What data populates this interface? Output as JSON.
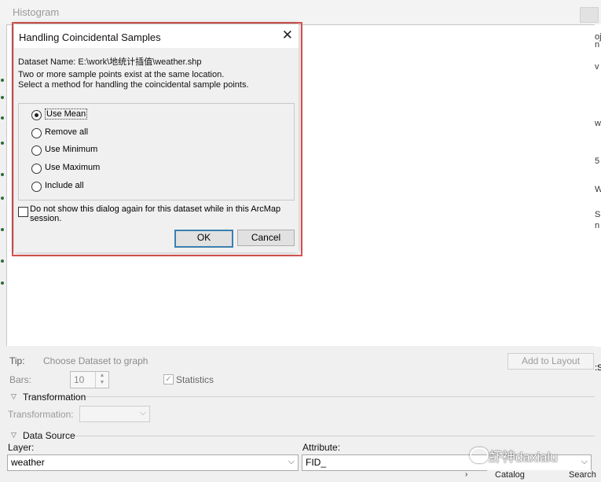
{
  "window": {
    "title": "Histogram",
    "partial_right_texts": [
      "oj",
      "n",
      "v",
      "w",
      "5",
      "W",
      "S",
      "n",
      ":S"
    ]
  },
  "bottom": {
    "tip_label": "Tip:",
    "tip_text": "Choose Dataset to graph",
    "add_to_layout": "Add to Layout",
    "bars_label": "Bars:",
    "bars_value": "10",
    "statistics_label": "Statistics",
    "statistics_checked": true,
    "transformation_section": "Transformation",
    "transformation_label": "Transformation:",
    "transformation_value": "",
    "data_source_section": "Data Source",
    "layer_label": "Layer:",
    "layer_value": "weather",
    "attribute_label": "Attribute:",
    "attribute_value": "FID_"
  },
  "dialog": {
    "title": "Handling Coincidental Samples",
    "dataset_line": "Dataset Name: E:\\work\\地统计插值\\weather.shp",
    "message_line1": "Two or more sample points exist at the same location.",
    "message_line2": "Select a method for handling the coincidental sample points.",
    "options": [
      {
        "label": "Use Mean",
        "selected": true
      },
      {
        "label": "Remove all",
        "selected": false
      },
      {
        "label": "Use Minimum",
        "selected": false
      },
      {
        "label": "Use Maximum",
        "selected": false
      },
      {
        "label": "Include all",
        "selected": false
      }
    ],
    "dont_show_text": "Do not show this dialog again for this dataset while in this ArcMap session.",
    "dont_show_checked": false,
    "ok_label": "OK",
    "cancel_label": "Cancel"
  },
  "watermark": {
    "text": "虾神daxialu"
  },
  "taskbar": {
    "catalog": "Catalog",
    "search": "Search"
  },
  "colors": {
    "highlight_border": "#d9534f",
    "default_button_border": "#3c7fb1"
  }
}
